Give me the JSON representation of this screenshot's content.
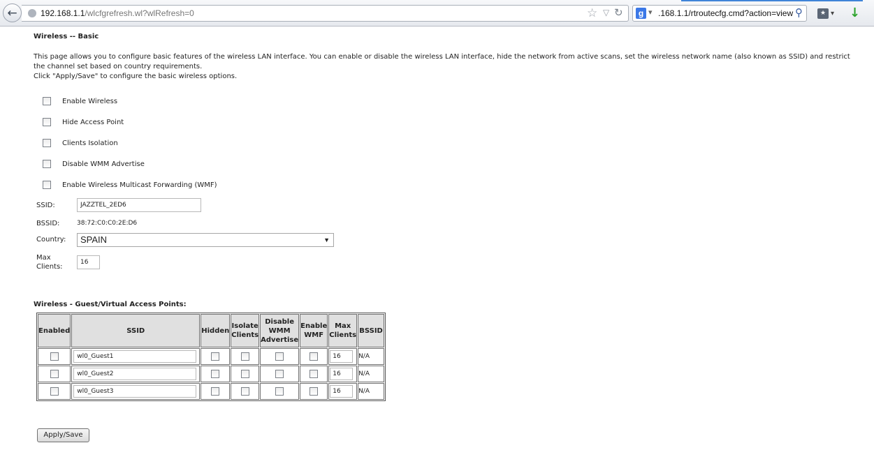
{
  "browser": {
    "url_host": "192.168.1.1",
    "url_path": "/wlcfgrefresh.wl?wlRefresh=0",
    "search_text": ".168.1.1/rtroutecfg.cmd?action=view",
    "search_engine_letter": "g"
  },
  "page": {
    "title": "Wireless -- Basic",
    "description_1": "This page allows you to configure basic features of the wireless LAN interface. You can enable or disable the wireless LAN interface, hide the network from active scans, set the wireless network name (also known as SSID) and restrict the channel set based on country requirements.",
    "description_2": "Click \"Apply/Save\" to configure the basic wireless options."
  },
  "options": [
    {
      "label": "Enable Wireless",
      "checked": false
    },
    {
      "label": "Hide Access Point",
      "checked": false
    },
    {
      "label": "Clients Isolation",
      "checked": false
    },
    {
      "label": "Disable WMM Advertise",
      "checked": false
    },
    {
      "label": "Enable Wireless Multicast Forwarding (WMF)",
      "checked": false
    }
  ],
  "fields": {
    "ssid_label": "SSID:",
    "ssid_value": "JAZZTEL_2ED6",
    "bssid_label": "BSSID:",
    "bssid_value": "38:72:C0:C0:2E:D6",
    "country_label": "Country:",
    "country_value": "SPAIN",
    "max_clients_label_1": "Max",
    "max_clients_label_2": "Clients:",
    "max_clients_value": "16"
  },
  "guest": {
    "title": "Wireless - Guest/Virtual Access Points:",
    "headers": {
      "enabled": "Enabled",
      "ssid": "SSID",
      "hidden": "Hidden",
      "isolate_1": "Isolate",
      "isolate_2": "Clients",
      "wmm_1": "Disable",
      "wmm_2": "WMM",
      "wmm_3": "Advertise",
      "wmf_1": "Enable",
      "wmf_2": "WMF",
      "max_1": "Max",
      "max_2": "Clients",
      "bssid": "BSSID"
    },
    "rows": [
      {
        "ssid": "wl0_Guest1",
        "max_clients": "16",
        "bssid": "N/A"
      },
      {
        "ssid": "wl0_Guest2",
        "max_clients": "16",
        "bssid": "N/A"
      },
      {
        "ssid": "wl0_Guest3",
        "max_clients": "16",
        "bssid": "N/A"
      }
    ]
  },
  "apply_label": "Apply/Save",
  "colors": {
    "download_arrow": "#2ea42e",
    "tab_edge": "#3f84d8"
  }
}
